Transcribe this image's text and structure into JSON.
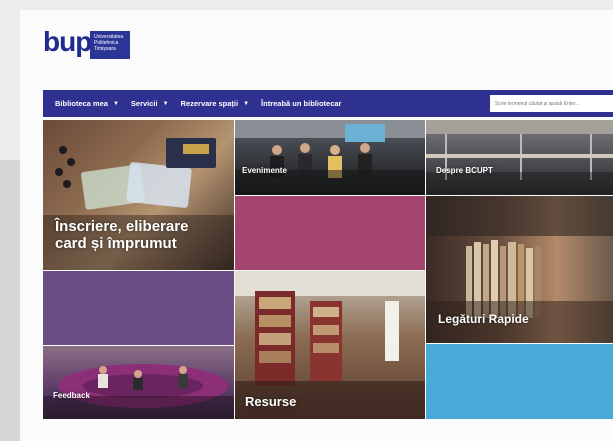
{
  "logo": {
    "text": "bup",
    "flag_lines": [
      "Universitatea",
      "Politehnica",
      "Timișoara"
    ]
  },
  "nav": {
    "items": [
      {
        "label": "Biblioteca mea",
        "caret": "▼"
      },
      {
        "label": "Servicii",
        "caret": "▼"
      },
      {
        "label": "Rezervare spații",
        "caret": "▼"
      },
      {
        "label": "Întreabă un bibliotecar",
        "caret": ""
      }
    ],
    "search_placeholder": "Scrie termenul căutat și apasă Enter..."
  },
  "tiles": {
    "inscriere": "Înscriere, eliberare card și împrumut",
    "evenimente": "Evenimente",
    "despre": "Despre BCUPT",
    "legaturi": "Legături Rapide",
    "resurse": "Resurse",
    "feedback": "Feedback"
  },
  "colors": {
    "nav": "#2f3190",
    "magenta": "#a4456f",
    "purple": "#6a4d84",
    "blue": "#48abd7"
  }
}
